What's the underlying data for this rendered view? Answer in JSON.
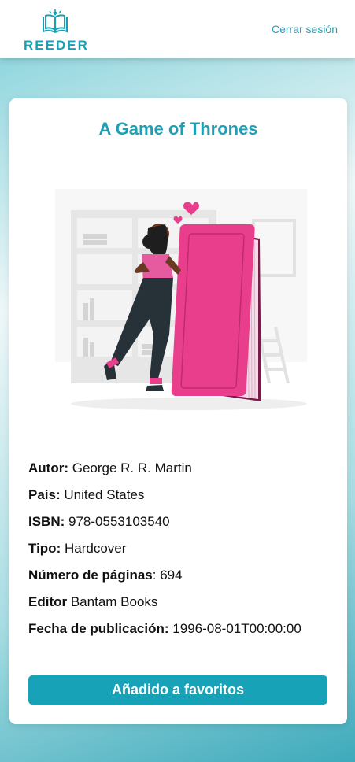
{
  "header": {
    "logo_text": "REEDER",
    "logout_label": "Cerrar sesión"
  },
  "book": {
    "title": "A Game of Thrones",
    "fields": [
      {
        "label": "Autor:",
        "value": "George R. R. Martin"
      },
      {
        "label": "País:",
        "value": "United States"
      },
      {
        "label": "ISBN:",
        "value": "978-0553103540"
      },
      {
        "label": "Tipo:",
        "value": "Hardcover"
      },
      {
        "label": "Número de páginas",
        "value": ": 694"
      },
      {
        "label": "Editor",
        "value": "Bantam Books"
      },
      {
        "label": "Fecha de publicación:",
        "value": "1996-08-01T00:00:00"
      }
    ]
  },
  "actions": {
    "favorite_label": "Añadido a favoritos"
  },
  "colors": {
    "accent": "#17a2b8",
    "book_pink": "#e83e8c"
  },
  "icons": {
    "logo": "open-book-icon"
  }
}
